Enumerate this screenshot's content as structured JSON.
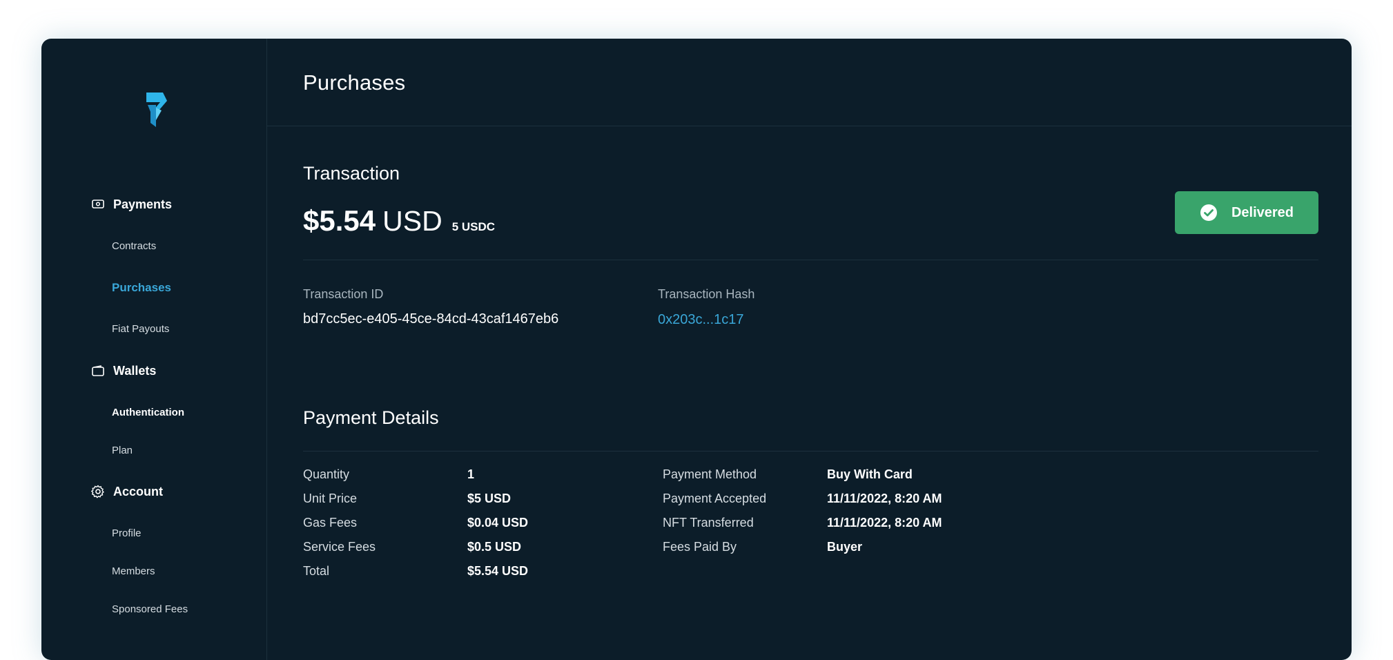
{
  "sidebar": {
    "sections": [
      {
        "label": "Payments",
        "icon": "money-icon"
      },
      {
        "label": "Wallets",
        "icon": "wallet-icon"
      },
      {
        "label": "Account",
        "icon": "gear-icon"
      }
    ],
    "items": {
      "contracts": "Contracts",
      "purchases": "Purchases",
      "fiat_payouts": "Fiat Payouts",
      "authentication": "Authentication",
      "plan": "Plan",
      "profile": "Profile",
      "members": "Members",
      "sponsored_fees": "Sponsored Fees"
    },
    "active_item": "Purchases"
  },
  "header": {
    "title": "Purchases"
  },
  "transaction": {
    "title": "Transaction",
    "amount": "$5.54",
    "currency": "USD",
    "crypto_amount": "5 USDC",
    "status": "Delivered",
    "id_label": "Transaction ID",
    "id_value": "bd7cc5ec-e405-45ce-84cd-43caf1467eb6",
    "hash_label": "Transaction Hash",
    "hash_value": "0x203c...1c17"
  },
  "payment_details": {
    "title": "Payment Details",
    "left": [
      {
        "label": "Quantity",
        "value": "1"
      },
      {
        "label": "Unit Price",
        "value": "$5 USD"
      },
      {
        "label": "Gas Fees",
        "value": "$0.04 USD"
      },
      {
        "label": "Service Fees",
        "value": "$0.5 USD"
      },
      {
        "label": "Total",
        "value": "$5.54 USD"
      }
    ],
    "right": [
      {
        "label": "Payment Method",
        "value": "Buy With Card"
      },
      {
        "label": "Payment Accepted",
        "value": "11/11/2022, 8:20 AM"
      },
      {
        "label": "NFT Transferred",
        "value": "11/11/2022, 8:20 AM"
      },
      {
        "label": "Fees Paid By",
        "value": "Buyer"
      }
    ]
  },
  "colors": {
    "background": "#0c1d29",
    "accent": "#3aa7d8",
    "success": "#39a46b"
  }
}
